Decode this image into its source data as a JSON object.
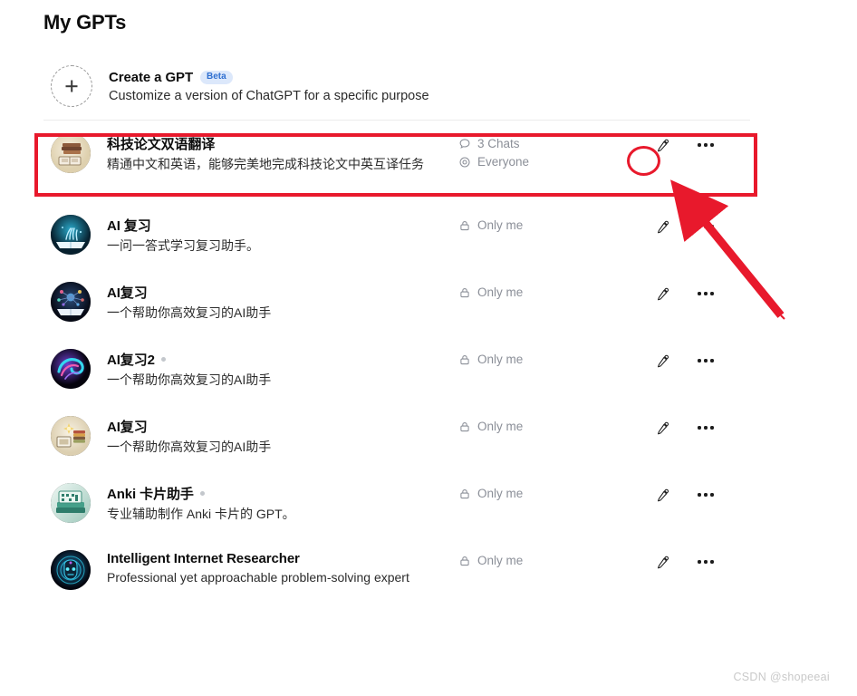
{
  "page": {
    "title": "My GPTs"
  },
  "create": {
    "icon": "plus-circle-dashed-icon",
    "title": "Create a GPT",
    "badge": "Beta",
    "subtitle": "Customize a version of ChatGPT for a specific purpose"
  },
  "actions": {
    "edit_icon": "pencil-icon",
    "more_icon": "ellipsis-icon"
  },
  "gpts": [
    {
      "title": "科技论文双语翻译",
      "subtitle": "精通中文和英语，能够完美地完成科技论文中英互译任务",
      "has_dot_badge": false,
      "avatar": "books-stack-avatar",
      "meta": [
        {
          "icon": "chat-bubble-icon",
          "label": "3 Chats"
        },
        {
          "icon": "globe-icon",
          "label": "Everyone"
        }
      ]
    },
    {
      "title": "AI 复习",
      "subtitle": "一问一答式学习复习助手。",
      "has_dot_badge": false,
      "avatar": "magic-book-avatar",
      "meta": [
        {
          "icon": "lock-icon",
          "label": "Only me"
        }
      ]
    },
    {
      "title": "AI复习",
      "subtitle": "一个帮助你高效复习的AI助手",
      "has_dot_badge": false,
      "avatar": "network-book-avatar",
      "meta": [
        {
          "icon": "lock-icon",
          "label": "Only me"
        }
      ]
    },
    {
      "title": "AI复习2",
      "subtitle": "一个帮助你高效复习的AI助手",
      "has_dot_badge": true,
      "avatar": "neon-swirl-avatar",
      "meta": [
        {
          "icon": "lock-icon",
          "label": "Only me"
        }
      ]
    },
    {
      "title": "AI复习",
      "subtitle": "一个帮助你高效复习的AI助手",
      "has_dot_badge": false,
      "avatar": "study-desk-avatar",
      "meta": [
        {
          "icon": "lock-icon",
          "label": "Only me"
        }
      ]
    },
    {
      "title": "Anki 卡片助手",
      "subtitle": "专业辅助制作 Anki 卡片的 GPT。",
      "has_dot_badge": true,
      "avatar": "card-stack-avatar",
      "meta": [
        {
          "icon": "lock-icon",
          "label": "Only me"
        }
      ]
    },
    {
      "title": "Intelligent Internet Researcher",
      "subtitle": "Professional yet approachable problem-solving expert",
      "has_dot_badge": false,
      "avatar": "robot-face-avatar",
      "meta": [
        {
          "icon": "lock-icon",
          "label": "Only me"
        }
      ]
    }
  ],
  "annotation": {
    "color": "#e8192c",
    "highlighted_row_index": 0,
    "circled_control": "edit-button"
  },
  "watermark": "CSDN @shopeeai"
}
